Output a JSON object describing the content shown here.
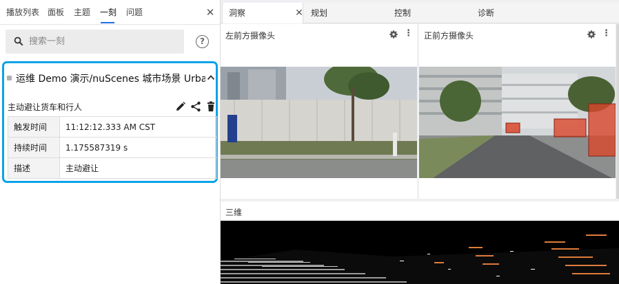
{
  "sidebar": {
    "tabs": [
      {
        "label": "播放列表"
      },
      {
        "label": "面板"
      },
      {
        "label": "主题"
      },
      {
        "label": "一刻"
      },
      {
        "label": "问题"
      }
    ],
    "active_tab_index": 3,
    "search": {
      "placeholder": "搜索一刻",
      "value": ""
    },
    "event": {
      "title": "运维 Demo 演示/nuScenes 城市场景 Urban",
      "name": "主动避让货车和行人",
      "fields": [
        {
          "key": "触发时间",
          "value": "11:12:12.333 AM CST"
        },
        {
          "key": "持续时间",
          "value": "1.175587319 s"
        },
        {
          "key": "描述",
          "value": "主动避让"
        }
      ]
    }
  },
  "main": {
    "tabs": [
      {
        "label": "洞察"
      },
      {
        "label": "规划"
      },
      {
        "label": "控制"
      },
      {
        "label": "诊断"
      }
    ],
    "active_tab_index": 0,
    "panels": {
      "left_camera": {
        "title": "左前方摄像头"
      },
      "front_camera": {
        "title": "正前方摄像头"
      },
      "three_d": {
        "title": "三维"
      }
    }
  },
  "colors": {
    "accent": "#1e6fe0",
    "card_border": "#0aa3e8",
    "box_red": "#d9472c"
  }
}
